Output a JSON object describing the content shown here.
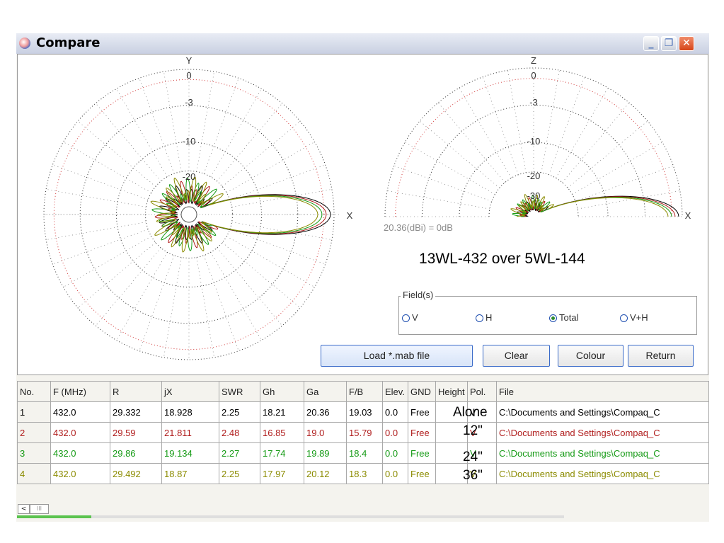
{
  "window": {
    "title": "Compare",
    "controls": {
      "minimize": "_",
      "maximize": "❐",
      "close": "✕"
    }
  },
  "plot": {
    "azimuth": {
      "axis_top_label": "Y",
      "axis_right_label": "X",
      "ring_labels": [
        "0",
        "-3",
        "-10",
        "-20"
      ]
    },
    "elevation": {
      "axis_top_label": "Z",
      "axis_right_label": "X",
      "ring_labels": [
        "0",
        "-3",
        "-10",
        "-20",
        "-30"
      ]
    },
    "reference": "20.36(dBi) = 0dB",
    "compare_title": "13WL-432 over 5WL-144",
    "series_colors": [
      "#000000",
      "#b01d1d",
      "#169b16",
      "#8b8b00"
    ]
  },
  "fields": {
    "legend": "Field(s)",
    "options": [
      {
        "label": "V",
        "selected": false
      },
      {
        "label": "H",
        "selected": false
      },
      {
        "label": "Total",
        "selected": true
      },
      {
        "label": "V+H",
        "selected": false
      }
    ]
  },
  "buttons": {
    "load": "Load *.mab file",
    "clear": "Clear",
    "colour": "Colour",
    "return": "Return"
  },
  "table": {
    "headers": [
      "No.",
      "F (MHz)",
      "R",
      "jX",
      "SWR",
      "Gh",
      "Ga",
      "F/B",
      "Elev.",
      "GND",
      "Height",
      "Pol.",
      "File"
    ],
    "rows": [
      {
        "color": "#000000",
        "cells": [
          "1",
          "432.0",
          "29.332",
          "18.928",
          "2.25",
          "18.21",
          "20.36",
          "19.03",
          "0.0",
          "Free",
          "",
          "V",
          "C:\\Documents and Settings\\Compaq_C"
        ]
      },
      {
        "color": "#b01d1d",
        "cells": [
          "2",
          "432.0",
          "29.59",
          "21.811",
          "2.48",
          "16.85",
          "19.0",
          "15.79",
          "0.0",
          "Free",
          "",
          "V",
          "C:\\Documents and Settings\\Compaq_C"
        ]
      },
      {
        "color": "#169b16",
        "cells": [
          "3",
          "432.0",
          "29.86",
          "19.134",
          "2.27",
          "17.74",
          "19.89",
          "18.4",
          "0.0",
          "Free",
          "",
          "V",
          "C:\\Documents and Settings\\Compaq_C"
        ]
      },
      {
        "color": "#8b8b00",
        "cells": [
          "4",
          "432.0",
          "29.492",
          "18.87",
          "2.25",
          "17.97",
          "20.12",
          "18.3",
          "0.0",
          "Free",
          "",
          "V",
          "C:\\Documents and Settings\\Compaq_C"
        ]
      }
    ],
    "height_annotations": [
      "Alone",
      "12\"",
      "24\"",
      "36\""
    ]
  },
  "scrollbar": {
    "left_arrow": "<",
    "thumb_grip": "III"
  }
}
